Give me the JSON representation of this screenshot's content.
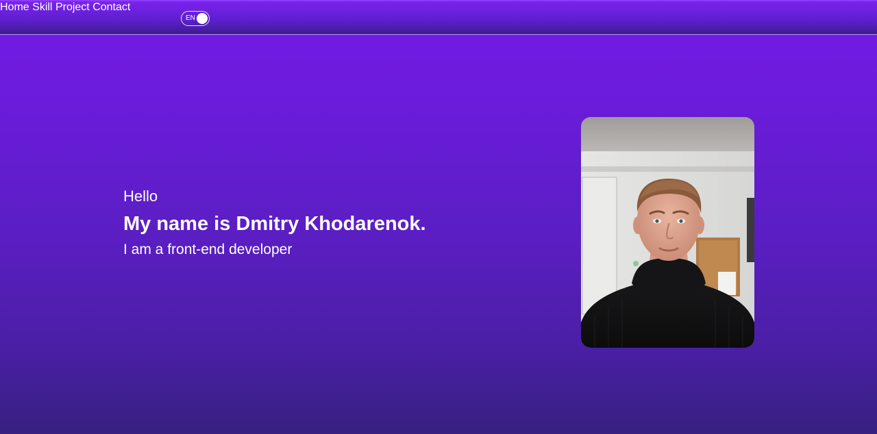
{
  "header": {
    "language_toggle": {
      "label": "EN",
      "state": "on"
    },
    "nav": [
      {
        "label": "Home"
      },
      {
        "label": "Skill"
      },
      {
        "label": "Project"
      },
      {
        "label": "Contact"
      }
    ]
  },
  "hero": {
    "greeting": "Hello",
    "name_line": "My name is Dmitry Khodarenok.",
    "role_line": "I am a front-end developer"
  },
  "profile_photo": {
    "icon": "portrait-photo"
  },
  "colors": {
    "background_top": "#751ae8",
    "background_bottom": "#37207f",
    "header_border": "#b89af2",
    "text": "#ffffff"
  }
}
